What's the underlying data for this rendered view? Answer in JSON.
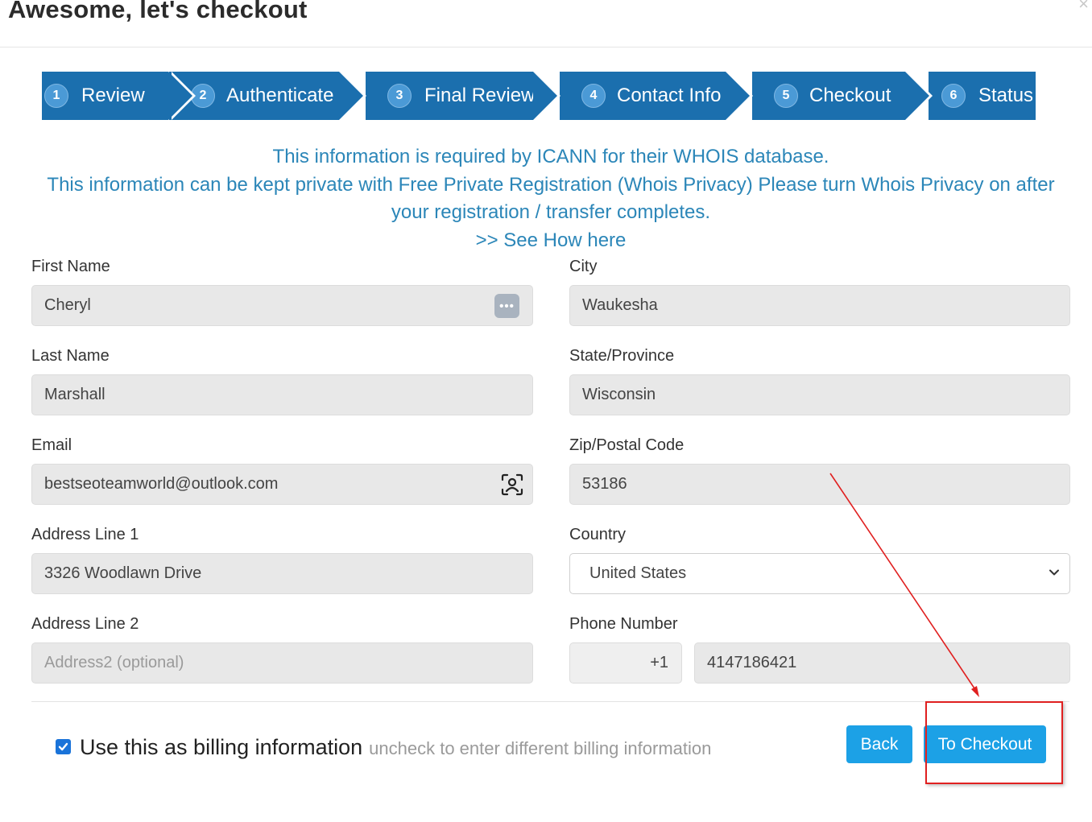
{
  "modal": {
    "title": "Awesome, let's checkout",
    "close": "×"
  },
  "steps": [
    {
      "num": "1",
      "label": "Review"
    },
    {
      "num": "2",
      "label": "Authenticate"
    },
    {
      "num": "3",
      "label": "Final Review"
    },
    {
      "num": "4",
      "label": "Contact Info"
    },
    {
      "num": "5",
      "label": "Checkout"
    },
    {
      "num": "6",
      "label": "Status"
    }
  ],
  "info": {
    "line1": "This information is required by ICANN for their WHOIS database.",
    "line2": "This information can be kept private with Free Private Registration (Whois Privacy) Please turn Whois Privacy on after your registration / transfer completes.",
    "link": ">> See How here"
  },
  "form": {
    "first_name": {
      "label": "First Name",
      "value": "Cheryl"
    },
    "last_name": {
      "label": "Last Name",
      "value": "Marshall"
    },
    "email": {
      "label": "Email",
      "value": "bestseoteamworld@outlook.com"
    },
    "address1": {
      "label": "Address Line 1",
      "value": "3326 Woodlawn Drive"
    },
    "address2": {
      "label": "Address Line 2",
      "placeholder": "Address2 (optional)"
    },
    "city": {
      "label": "City",
      "value": "Waukesha"
    },
    "state": {
      "label": "State/Province",
      "value": "Wisconsin"
    },
    "zip": {
      "label": "Zip/Postal Code",
      "value": "53186"
    },
    "country": {
      "label": "Country",
      "value": "United States"
    },
    "phone": {
      "label": "Phone Number",
      "code": "+1",
      "value": "4147186421"
    }
  },
  "billing": {
    "checked": true,
    "label": "Use this as billing information",
    "hint": "uncheck to enter different billing information"
  },
  "buttons": {
    "back": "Back",
    "checkout": "To Checkout"
  },
  "colors": {
    "step_bg": "#1b6fae",
    "info_text": "#2b86b8",
    "button": "#1ca1e6",
    "annotation": "#e02020"
  }
}
